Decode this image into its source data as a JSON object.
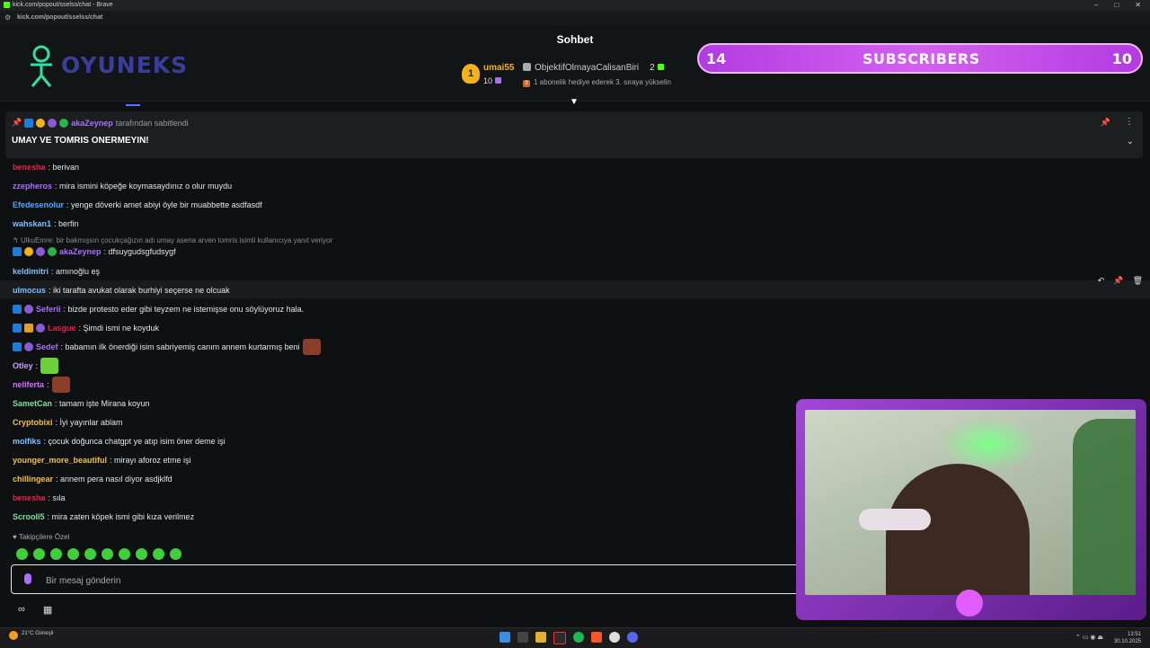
{
  "browser": {
    "tab_title": "kick.com/popout/sselss/chat - Brave",
    "url": "kick.com/popout/sselss/chat"
  },
  "header": {
    "logo_text": "OYUNEKS",
    "chat_title": "Sohbet",
    "sub_banner": {
      "left": "14",
      "label": "SUBSCRIBERS",
      "right": "10"
    },
    "leaderboard": {
      "first": {
        "rank": "1",
        "name": "umai55",
        "count": "10"
      },
      "second": {
        "name": "ObjektifOlmayaCalisanBiri",
        "count": "2"
      },
      "third_note": "1 abonelik hediye ederek 3. sıraya yükselin"
    }
  },
  "pinned": {
    "user": "akaZeynep",
    "suffix": "tarafından sabitlendi",
    "text": "UMAY VE TOMRIS ONERMEYIN!"
  },
  "messages": [
    {
      "user": "benesha",
      "color": "#e0204a",
      "text": ": berivan"
    },
    {
      "user": "zzepheros",
      "color": "#a970ff",
      "text": ": mira ismini köpeğe koymasaydınız o olur muydu"
    },
    {
      "user": "Efedesenolur",
      "color": "#4aa8ff",
      "text": ": yenge döverki amet abiyi öyle bir muabbette asdfasdf"
    },
    {
      "user": "wahskan1",
      "color": "#7ec0ff",
      "text": ": berfin"
    },
    {
      "reply": "UlkuEmre: bir bakmışsın çocukçağızın adı umay asena arven tomris isimli kullanıcıya yanıt veriyor"
    },
    {
      "user": "akaZeynep",
      "color": "#a970ff",
      "text": ": dfsuygudsgfudsygf"
    },
    {
      "user": "keldimitri",
      "color": "#7ec0ff",
      "text": ": amınoğlu eş"
    },
    {
      "user": "ulmocus",
      "color": "#7ec0ff",
      "text": ": iki tarafta avukat olarak burhiyi seçerse ne olcuak"
    },
    {
      "user": "Seferii",
      "color": "#a970ff",
      "text": ": bizde protesto eder gibi teyzem ne istemişse onu söylüyoruz hala."
    },
    {
      "user": "Lasgue",
      "color": "#e0204a",
      "text": ": Şimdi ismi ne koyduk"
    },
    {
      "user": "Sedef",
      "color": "#a970ff",
      "text": ": babamın ilk önerdiği isim sabriyemiş canım annem kurtarmış beni"
    },
    {
      "user": "Otley",
      "color": "#c8a0ff",
      "text": ":"
    },
    {
      "user": "neliferta",
      "color": "#d070ff",
      "text": ":"
    },
    {
      "user": "SametCan",
      "color": "#7ce0a0",
      "text": ": tamam işte Mirana koyun"
    },
    {
      "user": "Cryptobixi",
      "color": "#f0c040",
      "text": ": İyi yayınlar ablam"
    },
    {
      "user": "molfiks",
      "color": "#7ec0ff",
      "text": ": çocuk doğunca chatgpt ye atıp isim öner deme işi"
    },
    {
      "user": "younger_more_beautiful",
      "color": "#f0c040",
      "text": ": mirayı aforoz etme işi"
    },
    {
      "user": "chillingear",
      "color": "#f0c040",
      "text": ": annem pera nasıl diyor asdjklfd"
    },
    {
      "user": "benesha",
      "color": "#e0204a",
      "text": ": sıla"
    },
    {
      "user": "Scrooll5",
      "color": "#7ce0a0",
      "text": ": mira zaten köpek ismi gibi kıza verilmez"
    }
  ],
  "followers_only": "Takipçilere Özel",
  "input": {
    "placeholder": "Bir mesaj gönderin"
  },
  "taskbar": {
    "weather": "21°C Güneşli",
    "time": "13:51",
    "date": "30.10.2025"
  }
}
